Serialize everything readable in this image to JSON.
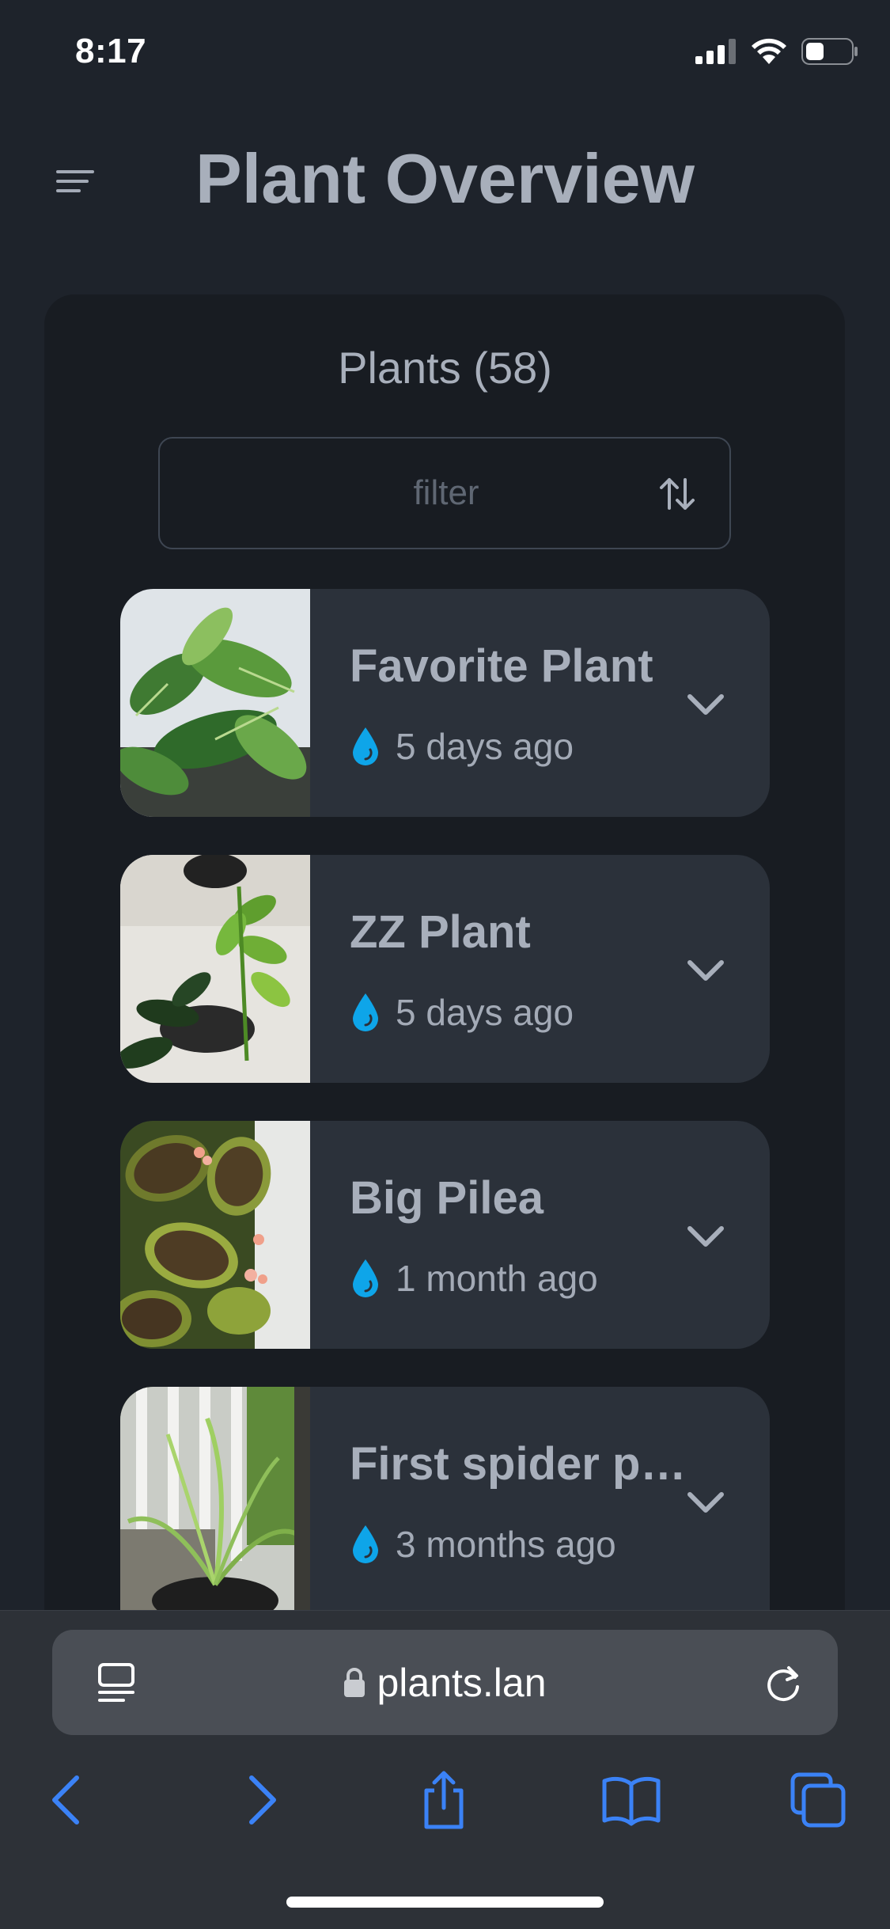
{
  "status_bar": {
    "time": "8:17",
    "icons": [
      "signal-icon",
      "wifi-icon",
      "battery-icon"
    ]
  },
  "header": {
    "title": "Plant Overview",
    "menu_icon": "menu-icon"
  },
  "plants_panel": {
    "heading": "Plants (58)",
    "filter": {
      "placeholder": "filter",
      "value": ""
    },
    "sort_icon": "sort-arrows-icon",
    "items": [
      {
        "name": "Favorite Plant",
        "watered": "5 days ago"
      },
      {
        "name": "ZZ Plant",
        "watered": "5 days ago"
      },
      {
        "name": "Big Pilea",
        "watered": "1 month ago"
      },
      {
        "name": "First spider plant",
        "watered": "3 months ago"
      }
    ]
  },
  "browser": {
    "url": "plants.lan",
    "toolbar": [
      "back-icon",
      "forward-icon",
      "share-icon",
      "bookmarks-icon",
      "tabs-icon"
    ]
  },
  "colors": {
    "background": "#1e232b",
    "panel": "#181c22",
    "card": "#2b313a",
    "text": "#a8afbb",
    "water_drop": "#0ea5e9",
    "browser_accent": "#3b82f6"
  }
}
